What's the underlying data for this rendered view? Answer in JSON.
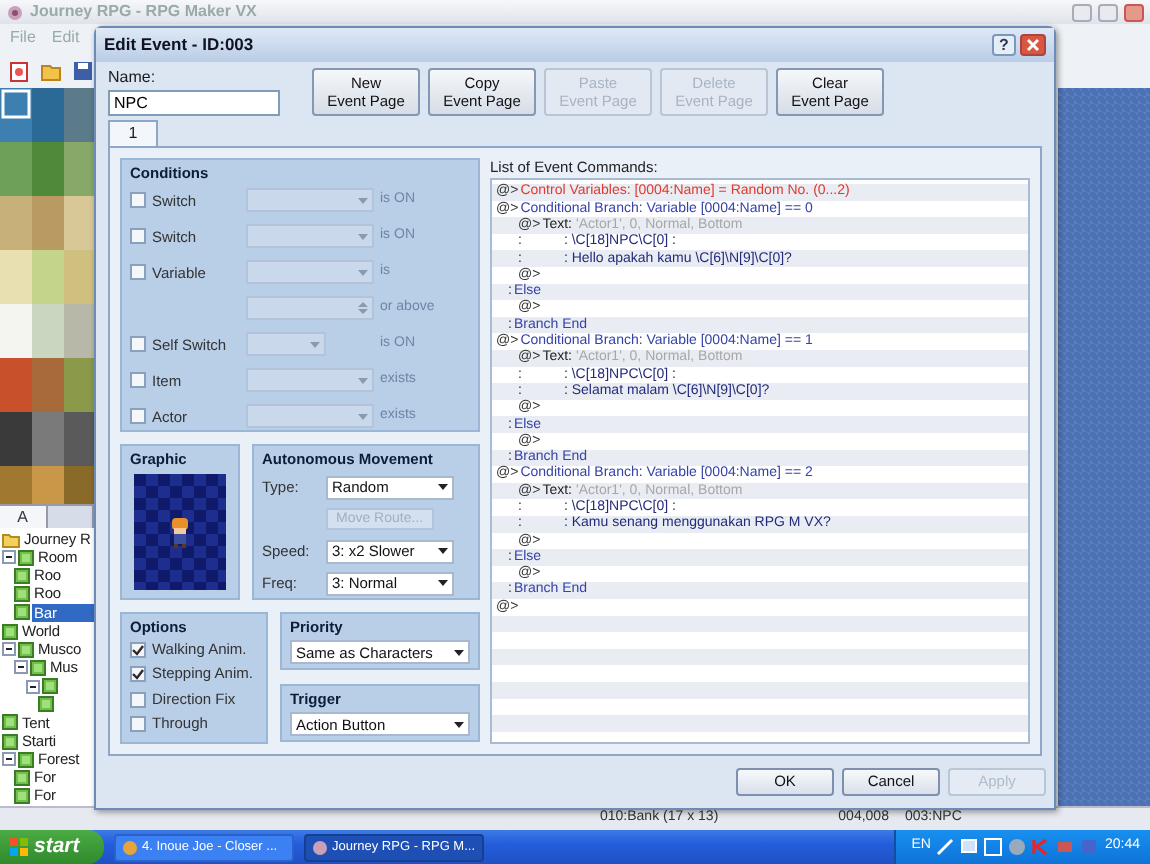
{
  "app": {
    "title": "Journey RPG - RPG Maker VX",
    "menu": [
      "File",
      "Edit"
    ],
    "palette_tabs": [
      {
        "label": "A",
        "selected": true
      },
      {
        "selected": false
      }
    ],
    "map_tree": [
      {
        "kind": "project",
        "label": "Journey R",
        "selected": false
      },
      {
        "kind": "map",
        "label": "Room",
        "selected": false,
        "expanded": true,
        "children": [
          {
            "kind": "map",
            "label": "Roo",
            "selected": false
          },
          {
            "kind": "map",
            "label": "Roo",
            "selected": false
          },
          {
            "kind": "map",
            "label": "Bar",
            "selected": true
          }
        ]
      },
      {
        "kind": "map",
        "label": "World",
        "selected": false
      },
      {
        "kind": "map",
        "label": "Musco",
        "selected": false,
        "expanded": true,
        "children": [
          {
            "kind": "map",
            "label": "Mus",
            "selected": false,
            "expanded": true,
            "children": [
              {
                "kind": "map",
                "selected": false,
                "expanded": true,
                "children": [
                  {
                    "kind": "map",
                    "selected": false
                  }
                ]
              }
            ]
          }
        ]
      },
      {
        "kind": "map",
        "label": "Tent",
        "selected": false
      },
      {
        "kind": "map",
        "label": "Starti",
        "selected": false
      },
      {
        "kind": "map",
        "label": "Forest",
        "selected": false,
        "expanded": true,
        "children": [
          {
            "kind": "map",
            "label": "For",
            "selected": false
          },
          {
            "kind": "map",
            "label": "For",
            "selected": false
          }
        ]
      }
    ],
    "status": [
      "010:Bank (17 x 13)",
      "004,008",
      "003:NPC"
    ]
  },
  "dialog": {
    "title": "Edit Event - ID:003",
    "help": "?",
    "name_label": "Name:",
    "name": "NPC",
    "page_buttons": [
      {
        "label": "New\nEvent Page",
        "disabled": false
      },
      {
        "label": "Copy\nEvent Page",
        "disabled": false
      },
      {
        "label": "Paste\nEvent Page",
        "disabled": true
      },
      {
        "label": "Delete\nEvent Page",
        "disabled": true
      },
      {
        "label": "Clear\nEvent Page",
        "disabled": false
      }
    ],
    "pages": [
      {
        "label": "1",
        "selected": true
      }
    ],
    "conditions": {
      "title": "Conditions",
      "rows": [
        {
          "kind": "select",
          "label": "Switch",
          "checked": false,
          "suffix": "is ON",
          "disabled": true
        },
        {
          "kind": "select",
          "label": "Switch",
          "checked": false,
          "suffix": "is ON",
          "disabled": true
        },
        {
          "kind": "select",
          "label": "Variable",
          "checked": false,
          "suffix": "is",
          "disabled": true
        },
        {
          "kind": "spin",
          "suffix": "or above",
          "disabled": true
        },
        {
          "kind": "short",
          "label": "Self Switch",
          "checked": false,
          "suffix": "is ON",
          "disabled": true
        },
        {
          "kind": "select",
          "label": "Item",
          "checked": false,
          "suffix": "exists",
          "disabled": true
        },
        {
          "kind": "select",
          "label": "Actor",
          "checked": false,
          "suffix": "exists",
          "disabled": true
        }
      ]
    },
    "graphic": {
      "title": "Graphic"
    },
    "movement": {
      "title": "Autonomous Movement",
      "fields": [
        {
          "kind": "select",
          "label": "Type:",
          "value": "Random"
        },
        {
          "kind": "button",
          "value": "Move Route...",
          "disabled": true
        },
        {
          "kind": "select",
          "label": "Speed:",
          "value": "3: x2 Slower"
        },
        {
          "kind": "select",
          "label": "Freq:",
          "value": "3: Normal"
        }
      ]
    },
    "options": {
      "title": "Options",
      "items": [
        {
          "label": "Walking Anim.",
          "checked": true
        },
        {
          "label": "Stepping Anim.",
          "checked": true
        },
        {
          "label": "Direction Fix",
          "checked": false
        },
        {
          "label": "Through",
          "checked": false
        }
      ]
    },
    "priority": {
      "title": "Priority",
      "value": "Same as Characters"
    },
    "trigger": {
      "title": "Trigger",
      "value": "Action Button"
    },
    "commands": {
      "title": "List of Event Commands:",
      "items": [
        {
          "marker": "@>",
          "kind": "control",
          "text": "Control Variables: [0004:Name] = Random No. (0...2)"
        },
        {
          "marker": "@>",
          "kind": "branch",
          "text": "Conditional Branch: Variable [0004:Name] == 0",
          "children": [
            {
              "marker": "@>",
              "kind": "message",
              "text": "Text:",
              "params": "'Actor1', 0, Normal, Bottom",
              "lines": [
                {
                  "marker": ":",
                  "text": ": \\C[18]NPC\\C[0] :"
                },
                {
                  "marker": ":",
                  "text": ": Hello apakah kamu \\C[6]\\N[9]\\C[0]?"
                }
              ]
            },
            {
              "marker": "@>",
              "kind": "empty"
            }
          ]
        },
        {
          "marker": ":",
          "kind": "branch",
          "text": "Else",
          "children": [
            {
              "marker": "@>",
              "kind": "empty"
            }
          ]
        },
        {
          "marker": ":",
          "kind": "branch",
          "text": "Branch End"
        },
        {
          "marker": "@>",
          "kind": "branch",
          "text": "Conditional Branch: Variable [0004:Name] == 1",
          "children": [
            {
              "marker": "@>",
              "kind": "message",
              "text": "Text:",
              "params": "'Actor1', 0, Normal, Bottom",
              "lines": [
                {
                  "marker": ":",
                  "text": ": \\C[18]NPC\\C[0] :"
                },
                {
                  "marker": ":",
                  "text": ": Selamat malam \\C[6]\\N[9]\\C[0]?"
                }
              ]
            },
            {
              "marker": "@>",
              "kind": "empty"
            }
          ]
        },
        {
          "marker": ":",
          "kind": "branch",
          "text": "Else",
          "children": [
            {
              "marker": "@>",
              "kind": "empty"
            }
          ]
        },
        {
          "marker": ":",
          "kind": "branch",
          "text": "Branch End"
        },
        {
          "marker": "@>",
          "kind": "branch",
          "text": "Conditional Branch: Variable [0004:Name] == 2",
          "children": [
            {
              "marker": "@>",
              "kind": "message",
              "text": "Text:",
              "params": "'Actor1', 0, Normal, Bottom",
              "lines": [
                {
                  "marker": ":",
                  "text": ": \\C[18]NPC\\C[0] :"
                },
                {
                  "marker": ":",
                  "text": ": Kamu senang menggunakan RPG M VX?"
                }
              ]
            },
            {
              "marker": "@>",
              "kind": "empty"
            }
          ]
        },
        {
          "marker": ":",
          "kind": "branch",
          "text": "Else",
          "children": [
            {
              "marker": "@>",
              "kind": "empty"
            }
          ]
        },
        {
          "marker": ":",
          "kind": "branch",
          "text": "Branch End"
        },
        {
          "marker": "@>",
          "kind": "empty"
        }
      ]
    },
    "buttons": [
      {
        "label": "OK",
        "disabled": false
      },
      {
        "label": "Cancel",
        "disabled": false
      },
      {
        "label": "Apply",
        "disabled": true
      }
    ]
  },
  "taskbar": {
    "start": "start",
    "tasks": [
      {
        "label": "4. Inoue Joe - Closer ...",
        "selected": false
      },
      {
        "label": "Journey RPG - RPG M...",
        "selected": true
      }
    ],
    "language": "EN",
    "clock": "20:44"
  }
}
